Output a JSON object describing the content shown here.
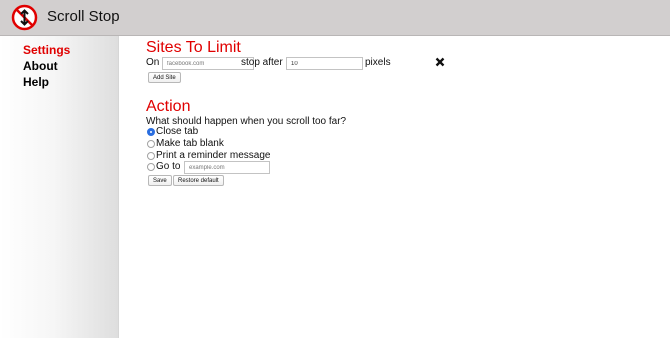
{
  "header": {
    "title": "Scroll Stop",
    "logo_icon": "no-scroll-sign-icon"
  },
  "sidebar": {
    "items": [
      {
        "label": "Settings",
        "active": true
      },
      {
        "label": "About",
        "active": false
      },
      {
        "label": "Help",
        "active": false
      }
    ]
  },
  "sites": {
    "title": "Sites To Limit",
    "on_label": "On",
    "site_placeholder": "facebook.com",
    "stop_after_label": "stop after",
    "pixels_value": "10",
    "pixels_label": "pixels",
    "remove_icon": "close-x-icon",
    "add_site_label": "Add Site"
  },
  "action": {
    "title": "Action",
    "question": "What should happen when you scroll too far?",
    "options": [
      {
        "label": "Close tab",
        "selected": true
      },
      {
        "label": "Make tab blank",
        "selected": false
      },
      {
        "label": "Print a reminder message",
        "selected": false
      },
      {
        "label": "Go to",
        "selected": false
      }
    ],
    "goto_placeholder": "example.com",
    "save_label": "Save",
    "restore_label": "Restore default"
  },
  "colors": {
    "accent": "#e00000",
    "header_bg": "#d2cfcf",
    "radio_selected": "#2a6ee0"
  }
}
